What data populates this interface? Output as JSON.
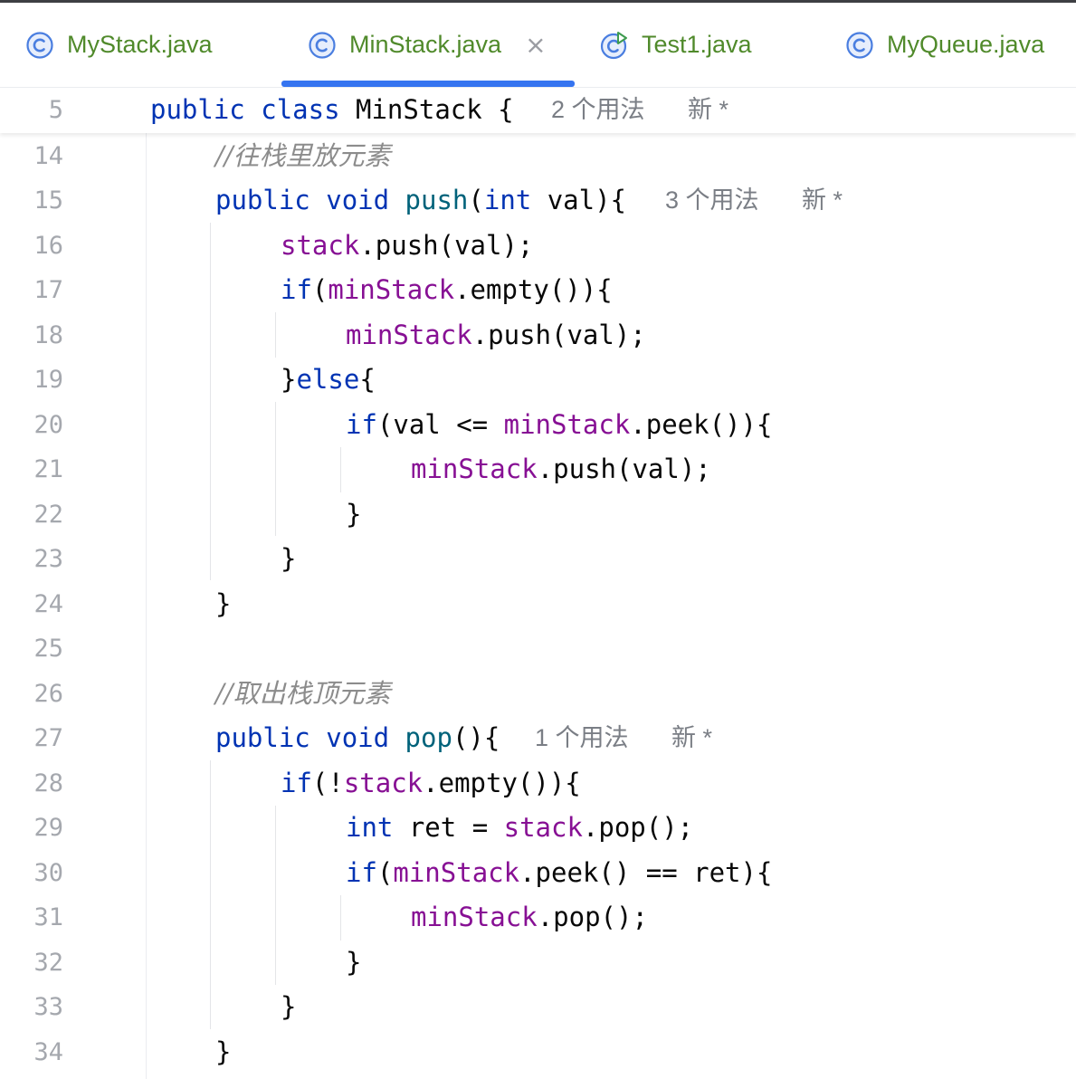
{
  "tabs": [
    {
      "label": "MyStack.java",
      "icon": "class-icon"
    },
    {
      "label": "MinStack.java",
      "icon": "class-icon",
      "active": true,
      "close": "×"
    },
    {
      "label": "Test1.java",
      "icon": "runnable-class-icon"
    },
    {
      "label": "MyQueue.java",
      "icon": "class-icon"
    }
  ],
  "sticky": {
    "line": "5",
    "kw1": "public",
    "kw2": "class",
    "name": "MinStack",
    "brace": "{",
    "usages": "2 个用法",
    "newmark": "新 *"
  },
  "lines": {
    "l14": {
      "n": "14",
      "comment": "//往栈里放元素"
    },
    "l15": {
      "n": "15",
      "kw1": "public",
      "kw2": "void",
      "fn": "push",
      "p1": "(",
      "kw3": "int",
      "rest": " val){",
      "usages": "3 个用法",
      "newmark": "新 *"
    },
    "l16": {
      "n": "16",
      "fld": "stack",
      "rest": ".push(val);"
    },
    "l17": {
      "n": "17",
      "kw": "if",
      "p1": "(",
      "fld": "minStack",
      "rest": ".empty()){"
    },
    "l18": {
      "n": "18",
      "fld": "minStack",
      "rest": ".push(val);"
    },
    "l19": {
      "n": "19",
      "p1": "}",
      "kw": "else",
      "rest": "{"
    },
    "l20": {
      "n": "20",
      "kw": "if",
      "p1": "(val <= ",
      "fld": "minStack",
      "rest": ".peek()){"
    },
    "l21": {
      "n": "21",
      "fld": "minStack",
      "rest": ".push(val);"
    },
    "l22": {
      "n": "22",
      "rest": "}"
    },
    "l23": {
      "n": "23",
      "rest": "}"
    },
    "l24": {
      "n": "24",
      "rest": "}"
    },
    "l25": {
      "n": "25"
    },
    "l26": {
      "n": "26",
      "comment": "//取出栈顶元素"
    },
    "l27": {
      "n": "27",
      "kw1": "public",
      "kw2": "void",
      "fn": "pop",
      "rest": "(){",
      "usages": "1 个用法",
      "newmark": "新 *"
    },
    "l28": {
      "n": "28",
      "kw": "if",
      "p1": "(!",
      "fld": "stack",
      "rest": ".empty()){"
    },
    "l29": {
      "n": "29",
      "kw": "int",
      "p1": " ret = ",
      "fld": "stack",
      "rest": ".pop();"
    },
    "l30": {
      "n": "30",
      "kw": "if",
      "p1": "(",
      "fld": "minStack",
      "rest": ".peek() == ret){"
    },
    "l31": {
      "n": "31",
      "fld": "minStack",
      "rest": ".pop();"
    },
    "l32": {
      "n": "32",
      "rest": "}"
    },
    "l33": {
      "n": "33",
      "rest": "}"
    },
    "l34": {
      "n": "34",
      "rest": "}"
    }
  },
  "colors": {
    "keyword": "#0033b3",
    "method": "#00627a",
    "field": "#871094",
    "comment": "#8c8c8c",
    "tab_text": "#508a2b",
    "tab_active_underline": "#3574f0",
    "class_icon": "#4a7ee0"
  }
}
